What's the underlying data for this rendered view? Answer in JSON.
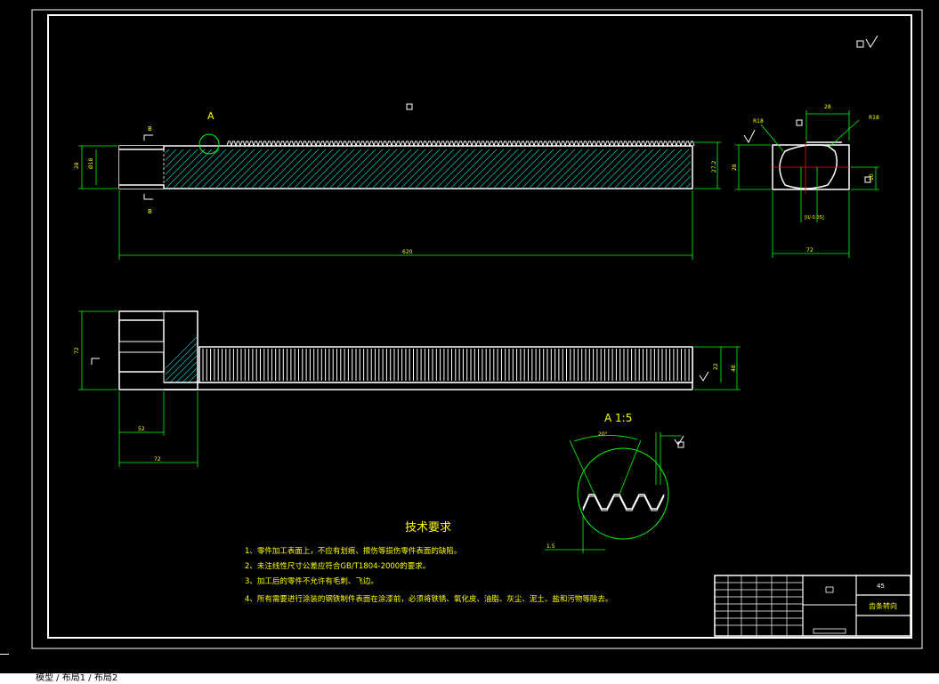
{
  "colors": {
    "background": "#000000",
    "frame": "#ffffff",
    "outline": "#ffffff",
    "dimension": "#00ff00",
    "hatch": "#00ffff",
    "center_line": "#ff0000",
    "text": "#ffff00"
  },
  "front_view": {
    "section_mark_top": "B",
    "section_mark_bottom": "B",
    "detail_marker": "A",
    "dim_height_left": "28",
    "dim_height_inner": "Ø18",
    "dim_length": "620",
    "dim_right": "27.2"
  },
  "side_view": {
    "dim_width_top": "28",
    "dim_height": "28",
    "dim_radius_left": "R18",
    "dim_radius_right": "R18",
    "dim_offset": "10",
    "dim_tolerance": "[0/-0.05]",
    "dim_bottom": "72"
  },
  "top_view": {
    "dim_left_height": "72",
    "dim_inner": "52",
    "dim_bottom": "72",
    "dim_right_a": "22",
    "dim_right_b": "48"
  },
  "detail_view": {
    "title": "A 1:5",
    "angle": "20°",
    "pitch": "1.5"
  },
  "tech_requirements": {
    "title": "技术要求",
    "items": [
      "1、零件加工表面上，不应有划痕、擦伤等损伤零件表面的缺陷。",
      "2、未注线性尺寸公差应符合GB/T1804-2000的要求。",
      "3、加工后的零件不允许有毛刺、飞边。",
      "4、所有需要进行涂装的钢铁制件表面在涂漆前，必须将铁锈、氧化皮、油脂、灰尘、泥土、盐和污物等除去。"
    ]
  },
  "title_block": {
    "material": "45",
    "part_name": "齿条转向"
  },
  "status_bar": {
    "text": "模型 / 布局1 / 布局2"
  }
}
